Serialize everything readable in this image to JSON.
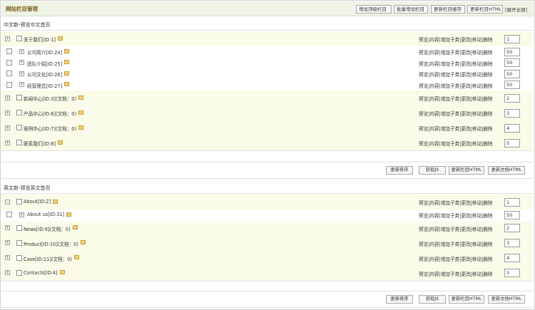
{
  "header": {
    "title": "网站栏目管理",
    "buttons": [
      "增加顶级栏目",
      "批量增加栏目",
      "更新栏目缓存",
      "更新栏目HTML"
    ],
    "expand_all": "[展开全部]"
  },
  "actions": [
    "预览",
    "内容",
    "增加子类",
    "更改",
    "移动",
    "删除"
  ],
  "sections": [
    {
      "title": "中文新-预览中文首页",
      "rows": [
        {
          "label": "关于我们[ID:1]",
          "order": "1",
          "level": 0,
          "pm": "+"
        },
        {
          "label": "公司简介[ID:24]",
          "order": "50",
          "level": 1,
          "pm": "+"
        },
        {
          "label": "团队介绍[ID:25]",
          "order": "50",
          "level": 1,
          "pm": "+"
        },
        {
          "label": "公司文化[ID:26]",
          "order": "50",
          "level": 1,
          "pm": "+"
        },
        {
          "label": "经营理念[ID:27]",
          "order": "50",
          "level": 1,
          "pm": "+"
        },
        {
          "label": "新闻中心[ID:3](文档：0)",
          "order": "2",
          "level": 0,
          "pm": "+"
        },
        {
          "label": "产品中心[ID:6](文档：0)",
          "order": "3",
          "level": 0,
          "pm": "+"
        },
        {
          "label": "案例中心[ID:7](文档：0)",
          "order": "4",
          "level": 0,
          "pm": "+"
        },
        {
          "label": "联系我们[ID:8]",
          "order": "5",
          "level": 0,
          "pm": "+"
        }
      ],
      "footer_buttons": [
        "更新排序",
        "获取JS",
        "更新栏目HTML",
        "更新文档HTML"
      ]
    },
    {
      "title": "英文新-预览英文首页",
      "rows": [
        {
          "label": "About[ID:2]",
          "order": "1",
          "level": 0,
          "pm": "−"
        },
        {
          "label": "About us[ID:31]",
          "order": "50",
          "level": 1,
          "pm": "+"
        },
        {
          "label": "News[ID:9](文档：0)",
          "order": "2",
          "level": 0,
          "pm": "+"
        },
        {
          "label": "Product[ID:10](文档：0)",
          "order": "3",
          "level": 0,
          "pm": "+"
        },
        {
          "label": "Case[ID:11](文档：0)",
          "order": "4",
          "level": 0,
          "pm": "+"
        },
        {
          "label": "Contacts[ID:4]",
          "order": "5",
          "level": 0,
          "pm": "+"
        }
      ],
      "footer_buttons": [
        "更新排序",
        "获取JS",
        "更新栏目HTML",
        "更新文档HTML"
      ]
    }
  ]
}
